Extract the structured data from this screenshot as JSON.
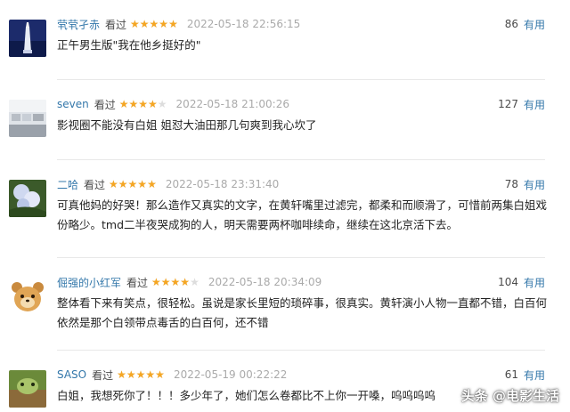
{
  "useful_label": "有用",
  "watched_label": "看过",
  "colors": {
    "username": "#3377aa",
    "star": "#f5a623",
    "time": "#aaaaaa"
  },
  "reviews": [
    {
      "username": "茕茕孑赤",
      "rating": 5,
      "time": "2022-05-18 22:56:15",
      "votes": "86",
      "content": "正午男生版\"我在他乡挺好的\""
    },
    {
      "username": "seven",
      "rating": 4,
      "time": "2022-05-18 21:00:26",
      "votes": "127",
      "content": "影视圈不能没有白姐 姐怼大油田那几句爽到我心坎了"
    },
    {
      "username": "二哈",
      "rating": 5,
      "time": "2022-05-18 23:31:40",
      "votes": "78",
      "content": "可真他妈的好哭！那么造作又真实的文字，在黄轩嘴里过滤完，都柔和而顺滑了，可惜前两集白姐戏份略少。tmd二半夜哭成狗的人，明天需要两杯咖啡续命，继续在这北京活下去。"
    },
    {
      "username": "倔强的小红军",
      "rating": 4,
      "time": "2022-05-18 20:34:09",
      "votes": "104",
      "content": "整体看下来有笑点，很轻松。虽说是家长里短的琐碎事，很真实。黄轩演小人物一直都不错，白百何依然是那个白领带点毒舌的白百何，还不错"
    },
    {
      "username": "SASO",
      "rating": 5,
      "time": "2022-05-19 00:22:22",
      "votes": "61",
      "content": "白姐，我想死你了！！！多少年了，她们怎么卷都比不上你一开嗓，呜呜呜呜"
    }
  ],
  "watermark": "头条 @电影生活"
}
